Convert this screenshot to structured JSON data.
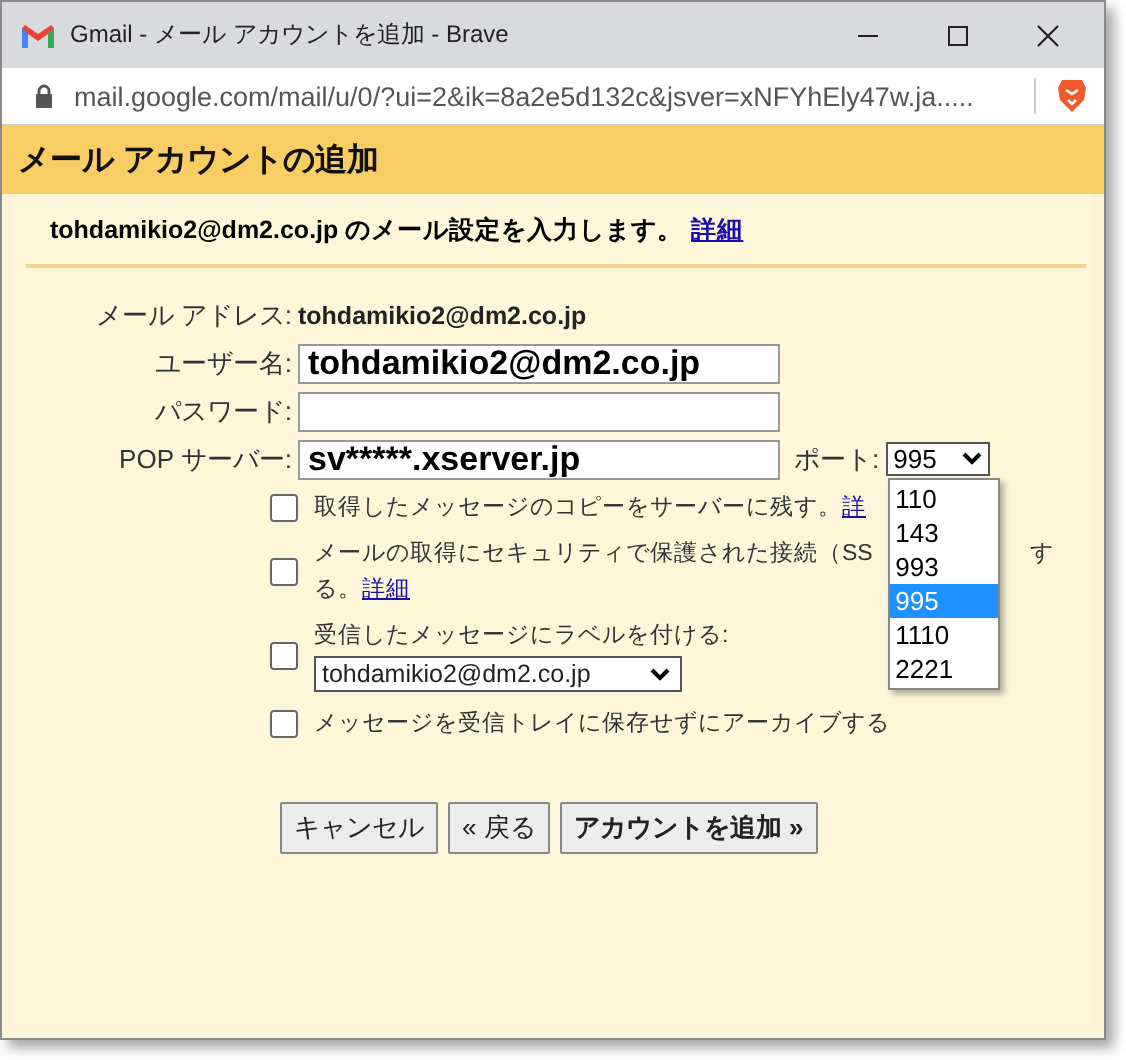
{
  "window": {
    "title": "Gmail - メール アカウントを追加 - Brave"
  },
  "address_bar": {
    "url": "mail.google.com/mail/u/0/?ui=2&ik=8a2e5d132c&jsver=xNFYhEly47w.ja....."
  },
  "dialog": {
    "title": "メール アカウントの追加",
    "intro": {
      "text": "tohdamikio2@dm2.co.jp のメール設定を入力します。",
      "link": "詳細"
    }
  },
  "fields": [
    {
      "kind": "static",
      "label": "メール アドレス:",
      "value": "tohdamikio2@dm2.co.jp"
    },
    {
      "kind": "input",
      "label": "ユーザー名:",
      "value": "tohdamikio2@dm2.co.jp"
    },
    {
      "kind": "input",
      "label": "パスワード:"
    },
    {
      "kind": "server",
      "label": "POP サーバー:",
      "value": "sv*****.xserver.jp"
    }
  ],
  "port": {
    "label": "ポート:",
    "value": "995",
    "expanded": true,
    "options": [
      {
        "label": "110",
        "selected": false
      },
      {
        "label": "143",
        "selected": false
      },
      {
        "label": "993",
        "selected": false
      },
      {
        "label": "995",
        "selected": true
      },
      {
        "label": "1110",
        "selected": false
      },
      {
        "label": "2221",
        "selected": false
      }
    ]
  },
  "options": [
    {
      "kind": "text_link",
      "checked": false,
      "text": "取得したメッセージのコピーをサーバーに残す。",
      "link": "詳"
    },
    {
      "kind": "wrapped",
      "checked": false,
      "text": "メールの取得にセキュリティで保護された接続（SS",
      "text_after": "す",
      "line2": "る。",
      "link": "詳細"
    },
    {
      "kind": "label_select",
      "checked": false,
      "text": "受信したメッセージにラベルを付ける:",
      "select": "tohdamikio2@dm2.co.jp"
    },
    {
      "kind": "text",
      "checked": false,
      "text": "メッセージを受信トレイに保存せずにアーカイブする"
    }
  ],
  "buttons": [
    {
      "label": "キャンセル",
      "primary": false
    },
    {
      "label": "« 戻る",
      "primary": false
    },
    {
      "label": "アカウントを追加 »",
      "primary": true
    }
  ]
}
